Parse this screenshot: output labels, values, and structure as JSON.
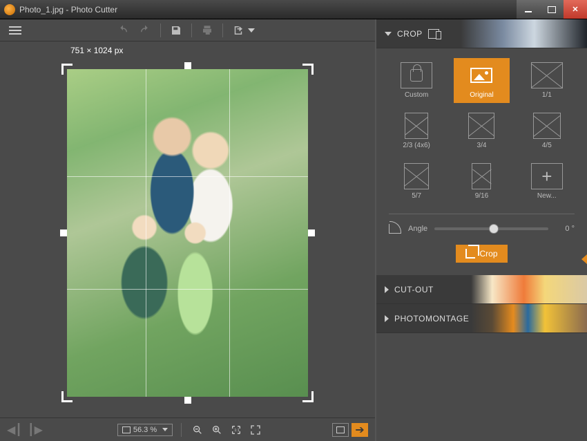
{
  "title": "Photo_1.jpg - Photo Cutter",
  "canvas": {
    "dimensions": "751 × 1024 px"
  },
  "zoom": {
    "value": "56.3 %"
  },
  "panels": {
    "crop": {
      "label": "CROP",
      "expanded": true
    },
    "cutout": {
      "label": "CUT-OUT",
      "expanded": false
    },
    "montage": {
      "label": "PHOTOMONTAGE",
      "expanded": false
    }
  },
  "ratios": [
    {
      "label": "Custom"
    },
    {
      "label": "Original"
    },
    {
      "label": "1/1"
    },
    {
      "label": "2/3 (4x6)"
    },
    {
      "label": "3/4"
    },
    {
      "label": "4/5"
    },
    {
      "label": "5/7"
    },
    {
      "label": "9/16"
    },
    {
      "label": "New..."
    }
  ],
  "angle": {
    "label": "Angle",
    "value": "0 °"
  },
  "cropButton": "Crop",
  "colors": {
    "accent": "#e38b1e"
  }
}
